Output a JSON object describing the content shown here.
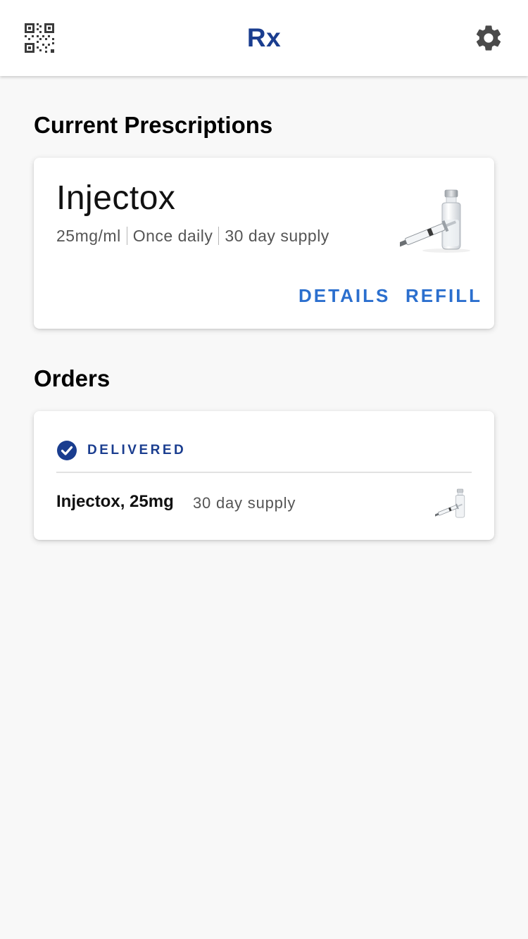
{
  "appbar": {
    "title": "Rx",
    "left_icon": "qr-code-icon",
    "right_icon": "gear-icon"
  },
  "prescriptions": {
    "section_title": "Current Prescriptions",
    "card": {
      "drug_name": "Injectox",
      "dose": "25mg/ml",
      "frequency": "Once daily",
      "supply": "30 day supply",
      "image_icon": "vial-syringe-icon",
      "details_label": "DETAILS",
      "refill_label": "REFILL"
    }
  },
  "orders": {
    "section_title": "Orders",
    "items": [
      {
        "status": "DELIVERED",
        "status_icon": "check-circle-icon",
        "name": "Injectox, 25mg",
        "supply": "30 day supply",
        "image_icon": "vial-syringe-icon"
      }
    ]
  },
  "colors": {
    "brand": "#1a3d8f",
    "accent": "#2b6fce",
    "background": "#f8f8f8",
    "card": "#ffffff"
  }
}
